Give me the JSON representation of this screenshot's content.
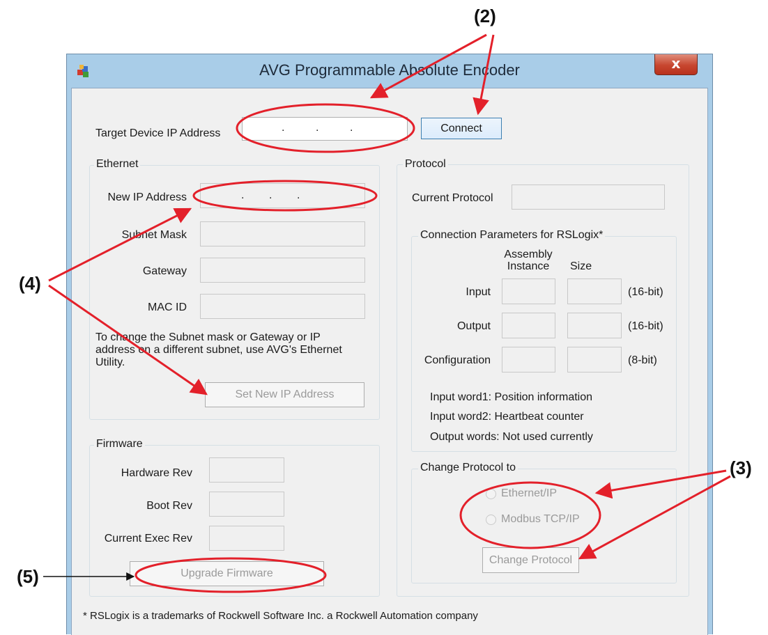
{
  "window": {
    "title": "AVG Programmable Absolute Encoder",
    "close_glyph": "x",
    "app_icon": "app-icon"
  },
  "target": {
    "label": "Target Device IP Address",
    "ip_dots": ".        .        .",
    "connect_label": "Connect"
  },
  "ethernet": {
    "group_label": "Ethernet",
    "new_ip_label": "New IP Address",
    "new_ip_dots": ".        .        .",
    "subnet_label": "Subnet Mask",
    "gateway_label": "Gateway",
    "mac_label": "MAC ID",
    "note": "To change the Subnet mask or Gateway or IP address on a different subnet, use AVG's Ethernet Utility.",
    "set_ip_button": "Set New IP Address"
  },
  "firmware": {
    "group_label": "Firmware",
    "hardware_label": "Hardware Rev",
    "boot_label": "Boot Rev",
    "exec_label": "Current Exec Rev",
    "upgrade_button": "Upgrade Firmware"
  },
  "protocol": {
    "group_label": "Protocol",
    "current_label": "Current Protocol",
    "connection": {
      "group_label": "Connection Parameters for RSLogix*",
      "col_assembly": "Assembly Instance",
      "col_size": "Size",
      "rows": [
        {
          "label": "Input",
          "unit": "(16-bit)"
        },
        {
          "label": "Output",
          "unit": "(16-bit)"
        },
        {
          "label": "Configuration",
          "unit": "(8-bit)"
        }
      ],
      "info": [
        "Input word1: Position information",
        "Input word2: Heartbeat counter",
        "Output words: Not used currently"
      ]
    },
    "change": {
      "group_label": "Change Protocol to",
      "options": [
        "Ethernet/IP",
        "Modbus TCP/IP"
      ],
      "button": "Change Protocol"
    }
  },
  "footer": "* RSLogix is a trademarks of Rockwell Software Inc. a Rockwell Automation company",
  "annotations": {
    "a2": "(2)",
    "a3": "(3)",
    "a4": "(4)",
    "a5": "(5)",
    "color": "#e3202a"
  }
}
